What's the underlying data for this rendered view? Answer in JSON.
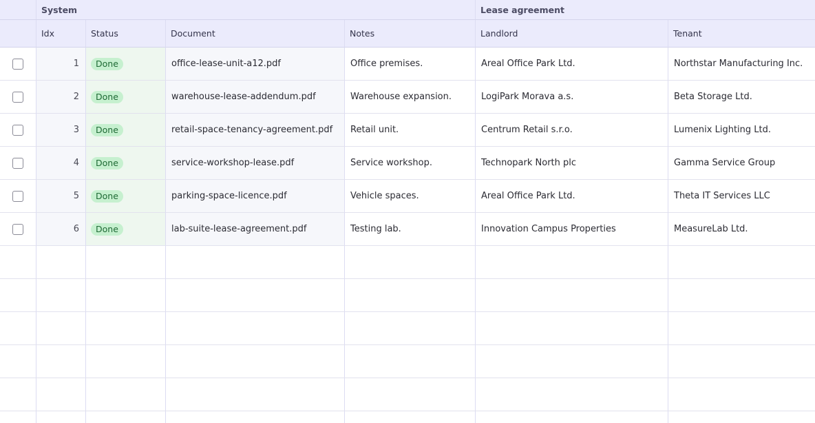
{
  "groups": {
    "system": "System",
    "lease": "Lease agreement"
  },
  "columns": {
    "idx": "Idx",
    "status": "Status",
    "document": "Document",
    "notes": "Notes",
    "landlord": "Landlord",
    "tenant": "Tenant"
  },
  "rows": [
    {
      "idx": "1",
      "status": "Done",
      "document": "office-lease-unit-a12.pdf",
      "notes": "Office premises.",
      "landlord": "Areal Office Park Ltd.",
      "tenant": "Northstar Manufacturing Inc."
    },
    {
      "idx": "2",
      "status": "Done",
      "document": "warehouse-lease-addendum.pdf",
      "notes": "Warehouse expansion.",
      "landlord": "LogiPark Morava a.s.",
      "tenant": "Beta Storage Ltd."
    },
    {
      "idx": "3",
      "status": "Done",
      "document": "retail-space-tenancy-agreement.pdf",
      "notes": "Retail unit.",
      "landlord": "Centrum Retail s.r.o.",
      "tenant": "Lumenix Lighting Ltd."
    },
    {
      "idx": "4",
      "status": "Done",
      "document": "service-workshop-lease.pdf",
      "notes": "Service workshop.",
      "landlord": "Technopark North plc",
      "tenant": "Gamma Service Group"
    },
    {
      "idx": "5",
      "status": "Done",
      "document": "parking-space-licence.pdf",
      "notes": "Vehicle spaces.",
      "landlord": "Areal Office Park Ltd.",
      "tenant": "Theta IT Services LLC"
    },
    {
      "idx": "6",
      "status": "Done",
      "document": "lab-suite-lease-agreement.pdf",
      "notes": "Testing lab.",
      "landlord": "Innovation Campus Properties",
      "tenant": "MeasureLab Ltd."
    }
  ],
  "colors": {
    "header_bg": "#ebebfc",
    "badge_bg": "#c6f0cf",
    "badge_text": "#1e6a34",
    "status_col_bg": "#eef7ef"
  }
}
